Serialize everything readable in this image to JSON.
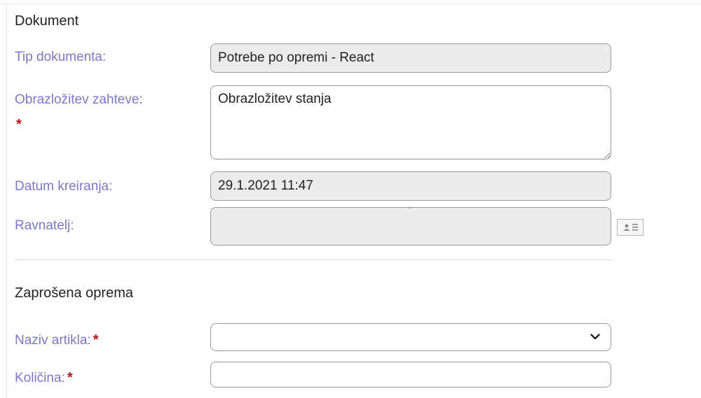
{
  "document": {
    "title": "Dokument",
    "doc_type": {
      "label": "Tip dokumenta:",
      "value": "Potrebe po opremi - React"
    },
    "justification": {
      "label": "Obrazložitev zahteve:",
      "required_mark": "*",
      "value": "Obrazložitev stanja"
    },
    "created": {
      "label": "Datum kreiranja:",
      "value": "29.1.2021 11:47"
    },
    "director": {
      "label": "Ravnatelj:",
      "value": "",
      "icon": "contact-card-icon"
    }
  },
  "equipment": {
    "title": "Zaprošena oprema",
    "item_name": {
      "label": "Naziv artikla:",
      "required_mark": "*",
      "selected": ""
    },
    "quantity": {
      "label": "Količina:",
      "required_mark": "*",
      "value": ""
    }
  },
  "colors": {
    "label": "#7b76d8",
    "required": "#cc1111",
    "readonly_bg": "#ececec"
  }
}
